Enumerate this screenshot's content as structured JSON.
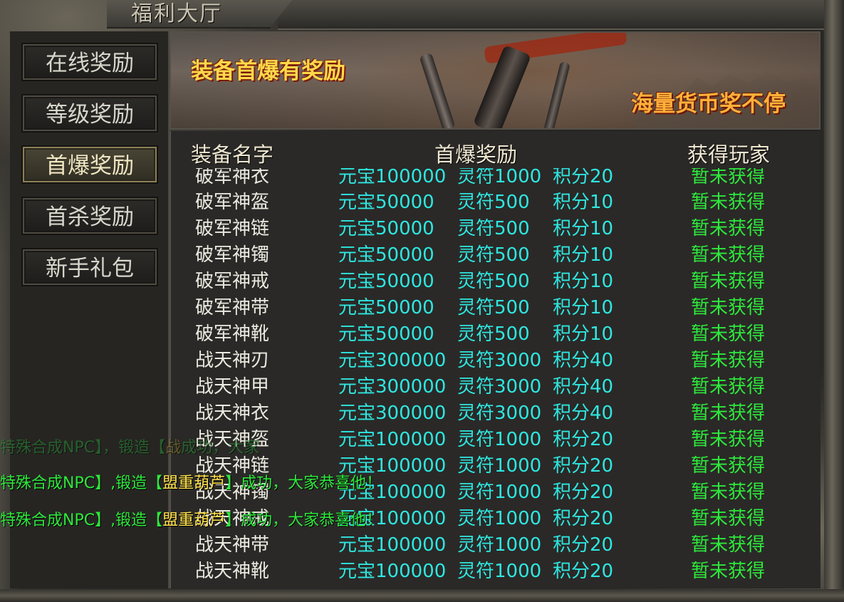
{
  "window": {
    "title": "福利大厅"
  },
  "menu": [
    {
      "label": "在线奖励",
      "active": false
    },
    {
      "label": "等级奖励",
      "active": false
    },
    {
      "label": "首爆奖励",
      "active": true
    },
    {
      "label": "首杀奖励",
      "active": false
    },
    {
      "label": "新手礼包",
      "active": false
    }
  ],
  "banner": {
    "text1": "装备首爆有奖励",
    "text2": "海量货币奖不停"
  },
  "table": {
    "headers": [
      "装备名字",
      "首爆奖励",
      "获得玩家"
    ],
    "rows": [
      {
        "name": "破军神衣",
        "yuanbao": "元宝100000",
        "lingfu": "灵符1000",
        "jifen": "积分20",
        "status": "暂未获得"
      },
      {
        "name": "破军神盔",
        "yuanbao": "元宝50000",
        "lingfu": "灵符500",
        "jifen": "积分10",
        "status": "暂未获得"
      },
      {
        "name": "破军神链",
        "yuanbao": "元宝50000",
        "lingfu": "灵符500",
        "jifen": "积分10",
        "status": "暂未获得"
      },
      {
        "name": "破军神镯",
        "yuanbao": "元宝50000",
        "lingfu": "灵符500",
        "jifen": "积分10",
        "status": "暂未获得"
      },
      {
        "name": "破军神戒",
        "yuanbao": "元宝50000",
        "lingfu": "灵符500",
        "jifen": "积分10",
        "status": "暂未获得"
      },
      {
        "name": "破军神带",
        "yuanbao": "元宝50000",
        "lingfu": "灵符500",
        "jifen": "积分10",
        "status": "暂未获得"
      },
      {
        "name": "破军神靴",
        "yuanbao": "元宝50000",
        "lingfu": "灵符500",
        "jifen": "积分10",
        "status": "暂未获得"
      },
      {
        "name": "战天神刃",
        "yuanbao": "元宝300000",
        "lingfu": "灵符3000",
        "jifen": "积分40",
        "status": "暂未获得"
      },
      {
        "name": "战天神甲",
        "yuanbao": "元宝300000",
        "lingfu": "灵符3000",
        "jifen": "积分40",
        "status": "暂未获得"
      },
      {
        "name": "战天神衣",
        "yuanbao": "元宝300000",
        "lingfu": "灵符3000",
        "jifen": "积分40",
        "status": "暂未获得"
      },
      {
        "name": "战天神盔",
        "yuanbao": "元宝100000",
        "lingfu": "灵符1000",
        "jifen": "积分20",
        "status": "暂未获得"
      },
      {
        "name": "战天神链",
        "yuanbao": "元宝100000",
        "lingfu": "灵符1000",
        "jifen": "积分20",
        "status": "暂未获得"
      },
      {
        "name": "战天神镯",
        "yuanbao": "元宝100000",
        "lingfu": "灵符1000",
        "jifen": "积分20",
        "status": "暂未获得"
      },
      {
        "name": "战天神戒",
        "yuanbao": "元宝100000",
        "lingfu": "灵符1000",
        "jifen": "积分20",
        "status": "暂未获得"
      },
      {
        "name": "战天神带",
        "yuanbao": "元宝100000",
        "lingfu": "灵符1000",
        "jifen": "积分20",
        "status": "暂未获得"
      },
      {
        "name": "战天神靴",
        "yuanbao": "元宝100000",
        "lingfu": "灵符1000",
        "jifen": "积分20",
        "status": "暂未获得"
      }
    ]
  },
  "chat": [
    {
      "pre": "特殊合成NPC】，锻造【",
      "item": "战",
      "post": "成功，大家",
      "faded": true
    },
    {
      "pre": "特殊合成NPC】,锻造【",
      "item": "盟重葫芦",
      "post": "】成功，大家恭喜他！",
      "faded": false
    },
    {
      "pre": "特殊合成NPC】,锻造【",
      "item": "盟重葫芦",
      "post": "】成功，大家恭喜他！",
      "faded": false
    }
  ],
  "colors": {
    "name_text": "#ece9e0",
    "reward_text": "#2fe6e0",
    "status_text": "#2ee83c",
    "banner_primary": "#ffd94a",
    "banner_secondary": "#ffb13a"
  }
}
